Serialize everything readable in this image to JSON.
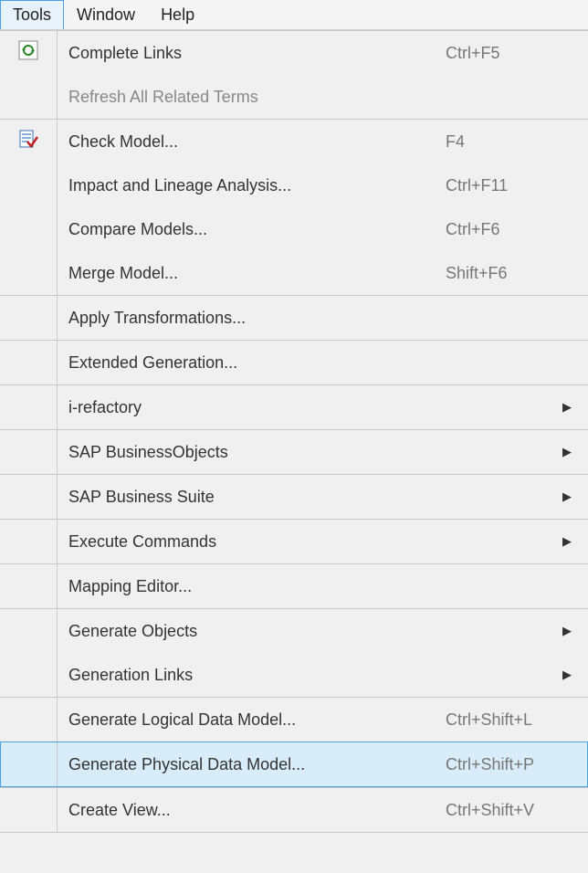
{
  "menubar": {
    "tools": "Tools",
    "window": "Window",
    "help": "Help"
  },
  "menu": {
    "complete_links": {
      "label": "Complete Links",
      "shortcut": "Ctrl+F5"
    },
    "refresh_terms": {
      "label": "Refresh All Related Terms"
    },
    "check_model": {
      "label": "Check Model...",
      "shortcut": "F4"
    },
    "impact_lineage": {
      "label": "Impact and Lineage Analysis...",
      "shortcut": "Ctrl+F11"
    },
    "compare_models": {
      "label": "Compare Models...",
      "shortcut": "Ctrl+F6"
    },
    "merge_model": {
      "label": "Merge Model...",
      "shortcut": "Shift+F6"
    },
    "apply_transformations": {
      "label": "Apply Transformations..."
    },
    "extended_generation": {
      "label": "Extended Generation..."
    },
    "i_refactory": {
      "label": "i-refactory"
    },
    "sap_businessobjects": {
      "label": "SAP BusinessObjects"
    },
    "sap_business_suite": {
      "label": "SAP Business Suite"
    },
    "execute_commands": {
      "label": "Execute Commands"
    },
    "mapping_editor": {
      "label": "Mapping Editor..."
    },
    "generate_objects": {
      "label": "Generate Objects"
    },
    "generation_links": {
      "label": "Generation Links"
    },
    "generate_logical": {
      "label": "Generate Logical Data Model...",
      "shortcut": "Ctrl+Shift+L"
    },
    "generate_physical": {
      "label": "Generate Physical Data Model...",
      "shortcut": "Ctrl+Shift+P"
    },
    "create_view": {
      "label": "Create View...",
      "shortcut": "Ctrl+Shift+V"
    }
  }
}
